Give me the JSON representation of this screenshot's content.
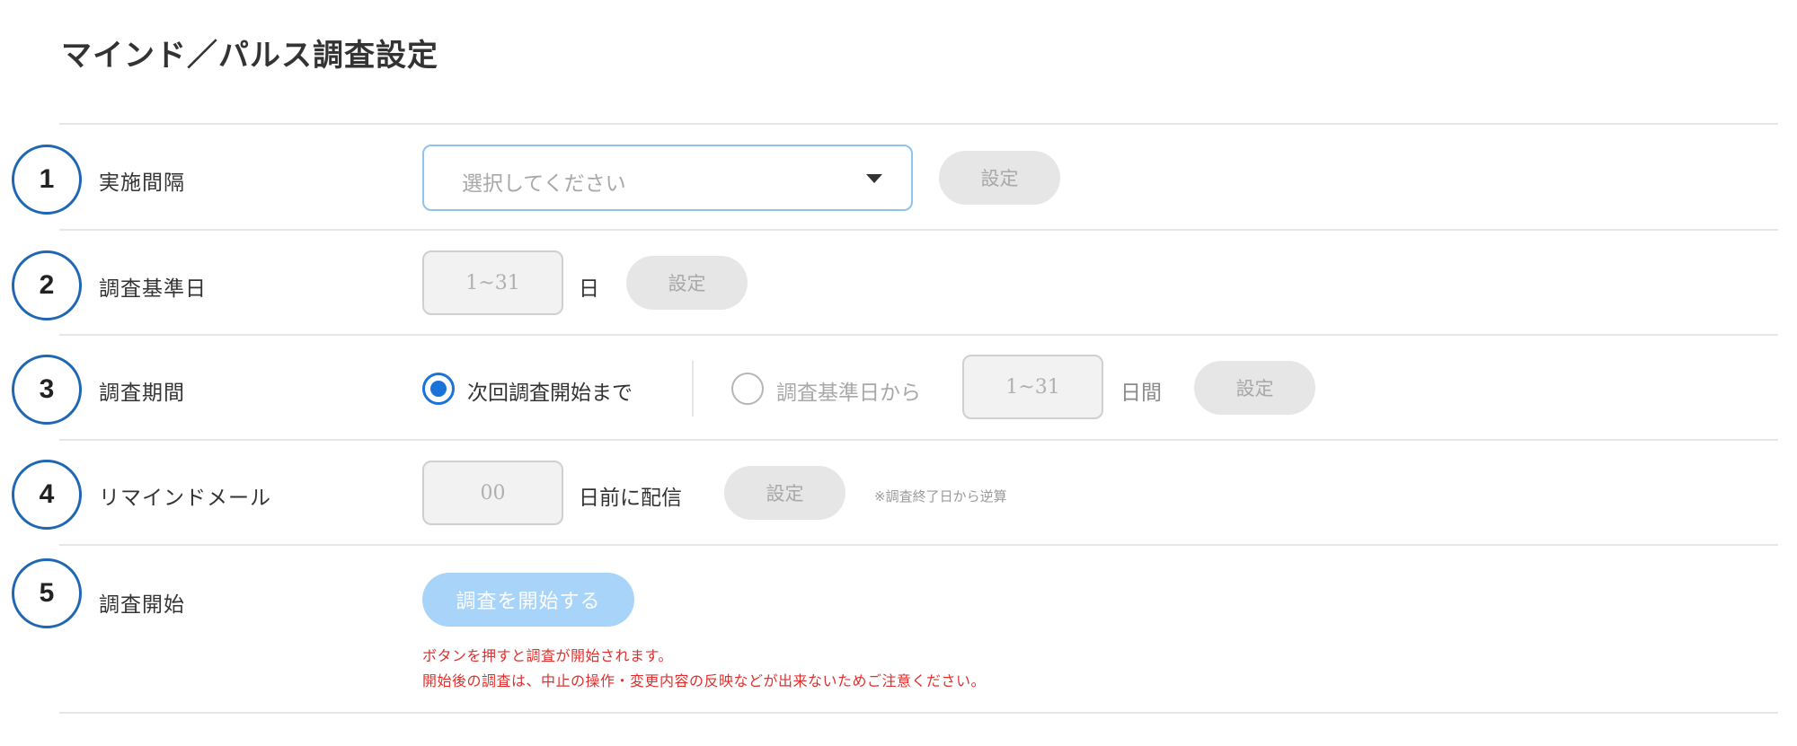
{
  "page": {
    "title": "マインド／パルス調査設定"
  },
  "rows": [
    {
      "number": "1",
      "label": "実施間隔"
    },
    {
      "number": "2",
      "label": "調査基準日"
    },
    {
      "number": "3",
      "label": "調査期間"
    },
    {
      "number": "4",
      "label": "リマインドメール"
    },
    {
      "number": "5",
      "label": "調査開始"
    }
  ],
  "interval": {
    "select_placeholder": "選択してください",
    "button": "設定"
  },
  "base_date": {
    "placeholder": "1~31",
    "unit": "日",
    "button": "設定"
  },
  "period": {
    "option_next_label": "次回調査開始まで",
    "option_next_selected": true,
    "option_days_label": "調査基準日から",
    "days_placeholder": "1~31",
    "days_unit": "日間",
    "button": "設定"
  },
  "reminder": {
    "placeholder": "00",
    "unit": "日前に配信",
    "button": "設定",
    "note": "※調査終了日から逆算"
  },
  "start": {
    "button": "調査を開始する",
    "warning_line1": "ボタンを押すと調査が開始されます。",
    "warning_line2": "開始後の調査は、中止の操作・変更内容の反映などが出来ないためご注意ください。"
  },
  "colors": {
    "accent": "#1a73d9",
    "circle_border": "#1f66b3",
    "warning": "#e0302e",
    "start_button": "#a8d4f9"
  }
}
